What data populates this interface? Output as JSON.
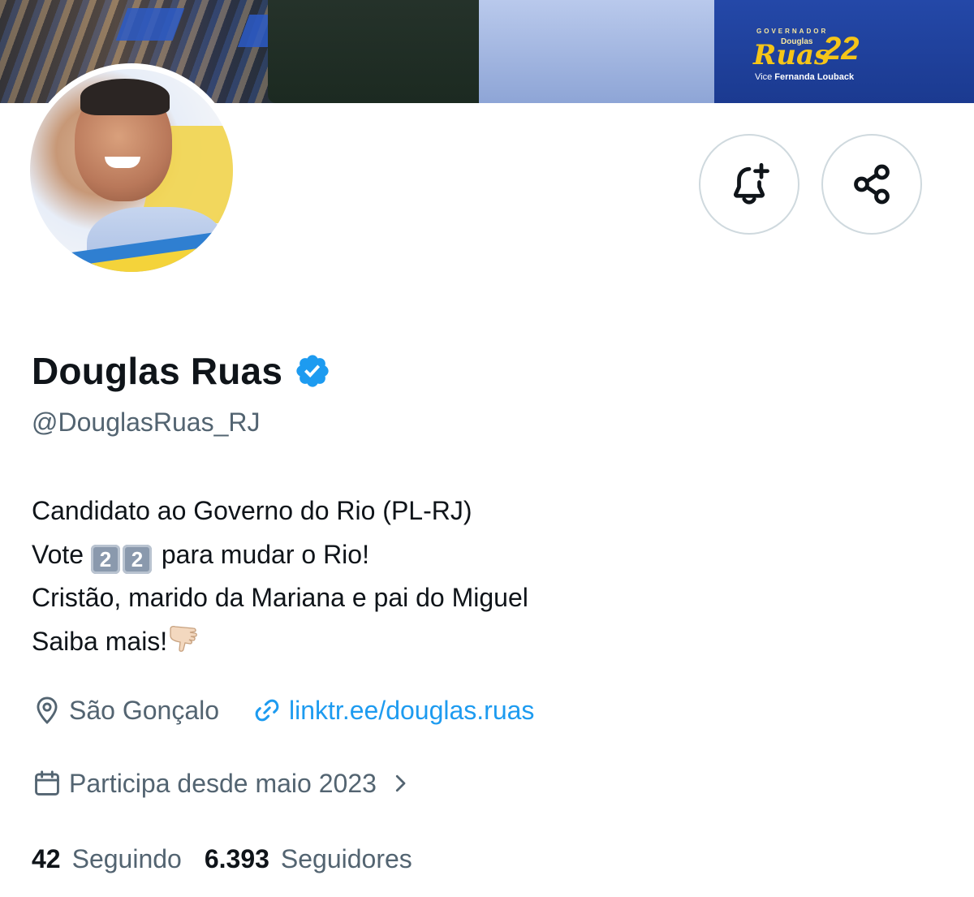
{
  "banner": {
    "logo_top": "GOVERNADOR",
    "logo_first": "Douglas",
    "logo_last": "Ruas",
    "logo_number": "22",
    "logo_vice_prefix": "Vice",
    "logo_vice_name": "Fernanda Louback"
  },
  "profile": {
    "name": "Douglas Ruas",
    "handle": "@DouglasRuas_RJ",
    "verified_color": "#1d9bf0"
  },
  "bio": {
    "line1": "Candidato ao Governo do Rio (PL-RJ)",
    "line2_prefix": "Vote",
    "keycap1": "2",
    "keycap2": "2",
    "line2_suffix": "para mudar o Rio!",
    "line3": "Cristão, marido da Mariana e pai do Miguel",
    "line4": "Saiba mais!"
  },
  "meta": {
    "location": "São Gonçalo",
    "link": "linktr.ee/douglas.ruas",
    "joined": "Participa desde maio 2023"
  },
  "counts": {
    "following_count": "42",
    "following_label": "Seguindo",
    "followers_count": "6.393",
    "followers_label": "Seguidores"
  },
  "icons": {
    "bell": "bell-plus-icon",
    "share": "share-icon",
    "location": "location-pin-icon",
    "link": "link-icon",
    "calendar": "calendar-icon",
    "chevron": "chevron-right-icon"
  },
  "colors": {
    "text_primary": "#0f1419",
    "text_secondary": "#536471",
    "link": "#1d9bf0",
    "logo_yellow": "#f5c518"
  }
}
